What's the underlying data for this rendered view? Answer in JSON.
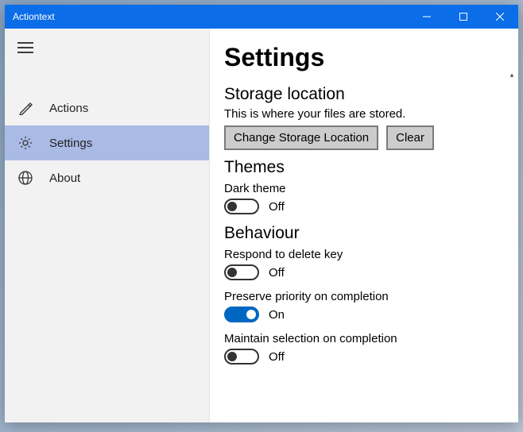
{
  "app": {
    "title": "Actiontext"
  },
  "sidebar": {
    "items": [
      {
        "label": "Actions",
        "active": false
      },
      {
        "label": "Settings",
        "active": true
      },
      {
        "label": "About",
        "active": false
      }
    ]
  },
  "page": {
    "title": "Settings",
    "sections": {
      "storage": {
        "title": "Storage location",
        "desc": "This is where your files are stored.",
        "change_btn": "Change Storage Location",
        "clear_btn": "Clear"
      },
      "themes": {
        "title": "Themes",
        "dark_label": "Dark theme",
        "dark_state": "Off"
      },
      "behaviour": {
        "title": "Behaviour",
        "delete_label": "Respond to delete key",
        "delete_state": "Off",
        "preserve_label": "Preserve priority on completion",
        "preserve_state": "On",
        "maintain_label": "Maintain selection on completion",
        "maintain_state": "Off"
      }
    }
  }
}
